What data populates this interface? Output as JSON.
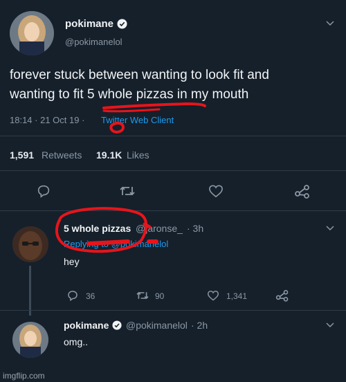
{
  "main_tweet": {
    "display_name": "pokimane",
    "handle": "@pokimanelol",
    "text_line1": "forever stuck between wanting to look fit and",
    "text_line2": "wanting to fit 5 whole pizzas in my mouth",
    "time_date": "18:14 · 21 Oct 19 ·",
    "client": "Twitter Web Client",
    "retweets_count": "1,591",
    "retweets_label": "Retweets",
    "likes_count": "19.1K",
    "likes_label": "Likes"
  },
  "reply1": {
    "display_name": "5 whole pizzas",
    "handle": "@jaronse_",
    "time": "· 3h",
    "replying_to": "Replying to @pokimanelol",
    "text": "hey",
    "reply_count": "36",
    "retweet_count": "90",
    "like_count": "1,341"
  },
  "reply2": {
    "display_name": "pokimane",
    "handle": "@pokimanelol",
    "time": "· 2h",
    "text": "omg.."
  },
  "watermark": "imgflip.com",
  "colors": {
    "background": "#15202b",
    "link": "#1d9bf0",
    "muted": "#8b98a5",
    "annotation": "#e8141b"
  }
}
